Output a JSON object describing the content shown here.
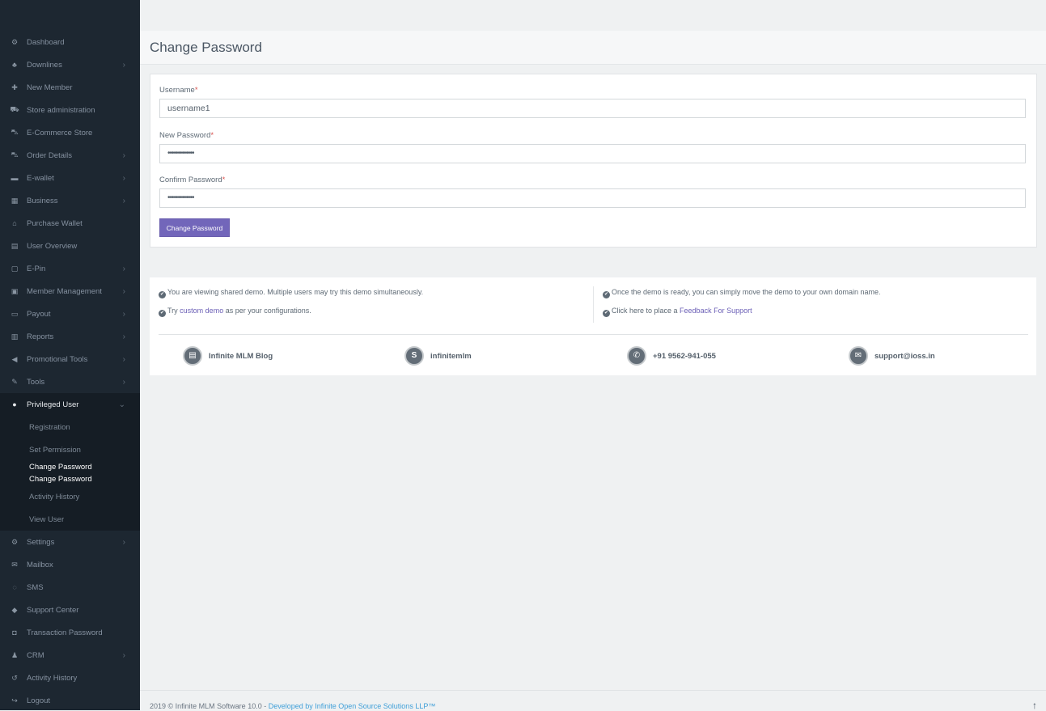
{
  "sidebar": {
    "items": [
      {
        "label": "Dashboard",
        "icon": "⚙",
        "chev": false
      },
      {
        "label": "Downlines",
        "icon": "♣",
        "chev": true
      },
      {
        "label": "New Member",
        "icon": "✚",
        "chev": false
      },
      {
        "label": "Store administration",
        "icon": "⛟",
        "chev": false
      },
      {
        "label": "E-Commerce Store",
        "icon": "⛍",
        "chev": false
      },
      {
        "label": "Order Details",
        "icon": "⛍",
        "chev": true
      },
      {
        "label": "E-wallet",
        "icon": "▬",
        "chev": true
      },
      {
        "label": "Business",
        "icon": "▦",
        "chev": true
      },
      {
        "label": "Purchase Wallet",
        "icon": "⌂",
        "chev": false
      },
      {
        "label": "User Overview",
        "icon": "▤",
        "chev": false
      },
      {
        "label": "E-Pin",
        "icon": "▢",
        "chev": true
      },
      {
        "label": "Member Management",
        "icon": "▣",
        "chev": true
      },
      {
        "label": "Payout",
        "icon": "▭",
        "chev": true
      },
      {
        "label": "Reports",
        "icon": "▥",
        "chev": true
      },
      {
        "label": "Promotional Tools",
        "icon": "◀",
        "chev": true
      },
      {
        "label": "Tools",
        "icon": "✎",
        "chev": true
      }
    ],
    "privileged": {
      "label": "Privileged User",
      "icon": "●",
      "chev": "⌄"
    },
    "sub_items": [
      "Registration",
      "Set Permission"
    ],
    "current_sub": [
      "Change Password",
      "Change Password"
    ],
    "sub_items_after": [
      "Activity History",
      "View User"
    ],
    "items_after": [
      {
        "label": "Settings",
        "icon": "⚙",
        "chev": true
      },
      {
        "label": "Mailbox",
        "icon": "✉",
        "chev": false
      },
      {
        "label": "SMS",
        "icon": "◌",
        "chev": false
      },
      {
        "label": "Support Center",
        "icon": "◆",
        "chev": false
      },
      {
        "label": "Transaction Password",
        "icon": "◘",
        "chev": false
      },
      {
        "label": "CRM",
        "icon": "♟",
        "chev": true
      },
      {
        "label": "Activity History",
        "icon": "↺",
        "chev": false
      },
      {
        "label": "Logout",
        "icon": "↪",
        "chev": false
      }
    ],
    "chev_glyph": "›"
  },
  "page": {
    "title": "Change Password"
  },
  "form": {
    "username_label": "Username",
    "username_value": "username1",
    "new_password_label": "New Password",
    "new_password_value": "•••••••••••••",
    "confirm_password_label": "Confirm Password",
    "confirm_password_value": "•••••••••••••",
    "required_mark": "*",
    "submit_label": "Change Password"
  },
  "info": {
    "line1": "You are viewing shared demo. Multiple users may try this demo simultaneously.",
    "line2_pre": "Try ",
    "line2_link": "custom demo",
    "line2_post": " as per your configurations.",
    "line3": "Once the demo is ready, you can simply move the demo to your own domain name.",
    "line4_pre": "Click here to place a ",
    "line4_link": "Feedback For Support",
    "check_glyph": "✔"
  },
  "contacts": [
    {
      "label": "Infinite MLM Blog",
      "icon": "▤"
    },
    {
      "label": "infinitemlm",
      "icon": "S"
    },
    {
      "label": "+91 9562-941-055",
      "icon": "✆"
    },
    {
      "label": "support@ioss.in",
      "icon": "✉"
    }
  ],
  "footer": {
    "text": "2019 © Infinite MLM Software 10.0 - ",
    "link": "Developed by Infinite Open Source Solutions LLP™",
    "up_glyph": "↑"
  }
}
